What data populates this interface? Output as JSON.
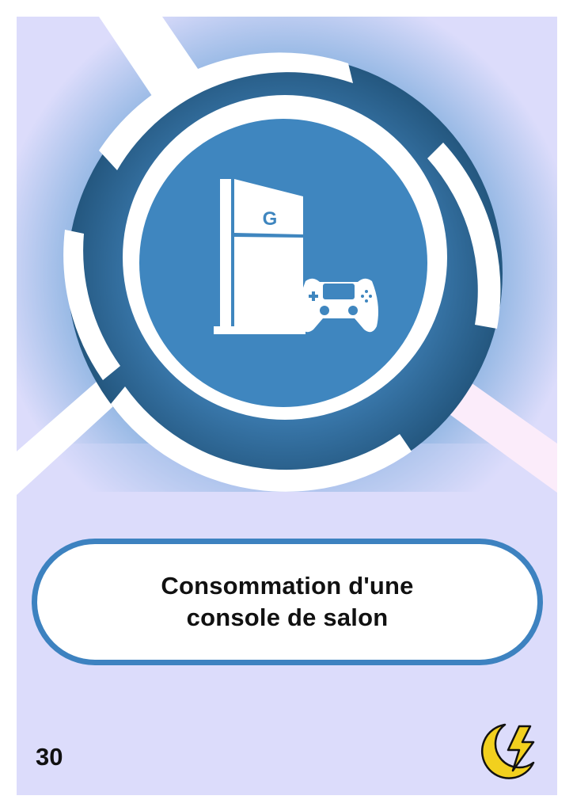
{
  "card": {
    "title_line_1": "Consommation d'une",
    "title_line_2": "console de salon",
    "number": "30",
    "console_logo_text": "G"
  },
  "colors": {
    "background": "#dcdcfb",
    "radial_center": "#4a89c2",
    "ring_dark": "#2f6a9c",
    "inner_circle": "#3f86bf",
    "title_border": "#3d82c0",
    "energy_yellow": "#f2d01e"
  },
  "icons": {
    "main": "game-console-and-controller-icon",
    "category": "lightning-moon-energy-icon"
  }
}
